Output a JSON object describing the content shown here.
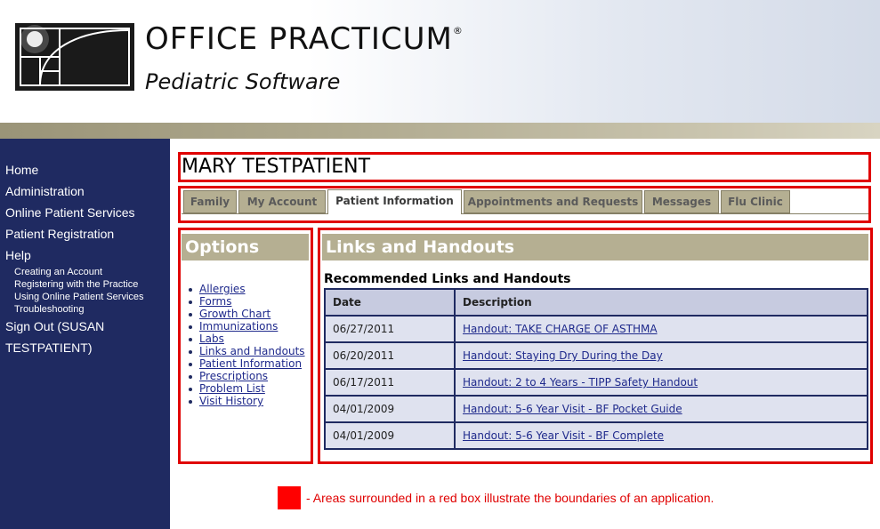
{
  "header": {
    "title": "OFFICE PRACTICUM",
    "registered": "®",
    "subtitle": "Pediatric Software"
  },
  "sidebar": {
    "items": [
      {
        "label": "Home"
      },
      {
        "label": "Administration"
      },
      {
        "label": "Online Patient Services"
      },
      {
        "label": "Patient Registration"
      },
      {
        "label": "Help"
      }
    ],
    "help_items": [
      {
        "label": "Creating an Account"
      },
      {
        "label": "Registering with the Practice"
      },
      {
        "label": "Using Online Patient Services"
      },
      {
        "label": "Troubleshooting"
      }
    ],
    "sign_out_line1": "Sign Out (SUSAN",
    "sign_out_line2": "TESTPATIENT)"
  },
  "patient": {
    "name": "MARY TESTPATIENT"
  },
  "tabs": [
    {
      "label": "Family"
    },
    {
      "label": "My Account"
    },
    {
      "label": "Patient Information"
    },
    {
      "label": "Appointments and Requests"
    },
    {
      "label": "Messages"
    },
    {
      "label": "Flu Clinic"
    }
  ],
  "options": {
    "title": "Options",
    "items": [
      {
        "label": "Allergies"
      },
      {
        "label": "Forms"
      },
      {
        "label": "Growth Chart"
      },
      {
        "label": "Immunizations"
      },
      {
        "label": "Labs"
      },
      {
        "label": "Links and Handouts"
      },
      {
        "label": "Patient Information"
      },
      {
        "label": "Prescriptions"
      },
      {
        "label": "Problem List"
      },
      {
        "label": "Visit History"
      }
    ]
  },
  "links": {
    "title": "Links and Handouts",
    "subtitle": "Recommended Links and Handouts",
    "columns": {
      "date": "Date",
      "description": "Description"
    },
    "rows": [
      {
        "date": "06/27/2011",
        "description": "Handout: TAKE CHARGE OF ASTHMA"
      },
      {
        "date": "06/20/2011",
        "description": "Handout: Staying Dry During the Day"
      },
      {
        "date": "06/17/2011",
        "description": "Handout: 2 to 4 Years - TIPP Safety Handout"
      },
      {
        "date": "04/01/2009",
        "description": "Handout: 5-6 Year Visit - BF Pocket Guide"
      },
      {
        "date": "04/01/2009",
        "description": "Handout: 5-6 Year Visit - BF Complete"
      }
    ]
  },
  "legend": {
    "text": "- Areas surrounded in a red box illustrate the boundaries of an application.",
    "swatch_color": "#ff0000"
  }
}
